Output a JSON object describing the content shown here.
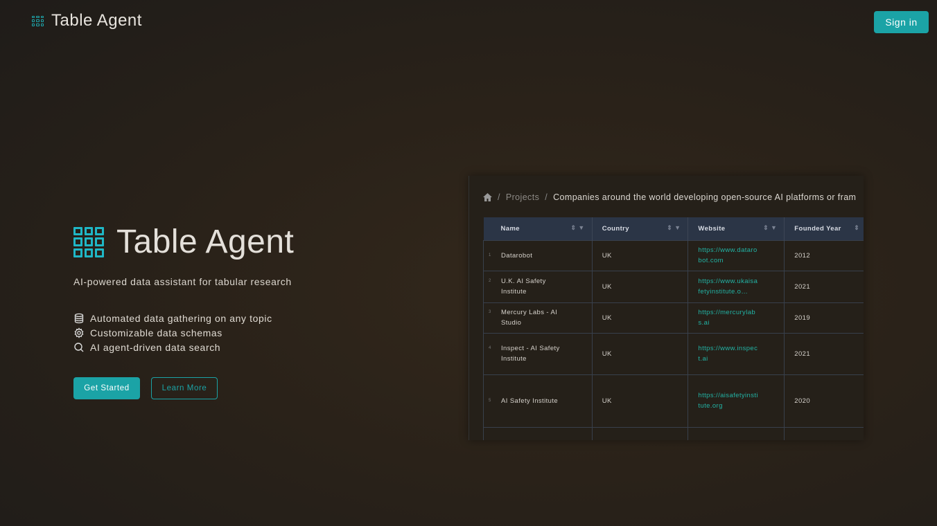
{
  "header": {
    "app_name": "Table Agent",
    "sign_in": "Sign in"
  },
  "hero": {
    "title": "Table Agent",
    "tagline": "AI-powered data assistant for tabular research",
    "features": [
      {
        "icon": "database-icon",
        "text": "Automated data gathering on any topic"
      },
      {
        "icon": "gear-icon",
        "text": "Customizable data schemas"
      },
      {
        "icon": "search-icon",
        "text": "AI agent-driven data search"
      }
    ],
    "get_started": "Get Started",
    "learn_more": "Learn More"
  },
  "preview": {
    "breadcrumb": {
      "sep": "/",
      "projects": "Projects",
      "current": "Companies around the world developing open-source AI platforms or fram"
    },
    "columns": [
      "Name",
      "Country",
      "Website",
      "Founded Year"
    ],
    "rows": [
      {
        "num": "1",
        "name": "Datarobot",
        "country": "UK",
        "website": "https://www.datarobot.com",
        "year": "2012"
      },
      {
        "num": "2",
        "name": "U.K. AI Safety Institute",
        "country": "UK",
        "website": "https://www.ukaisafetyinstitute.o…",
        "year": "2021"
      },
      {
        "num": "3",
        "name": "Mercury Labs - AI Studio",
        "country": "UK",
        "website": "https://mercurylabs.ai",
        "year": "2019"
      },
      {
        "num": "4",
        "name": "Inspect - AI Safety Institute",
        "country": "UK",
        "website": "https://www.inspect.ai",
        "year": "2021"
      },
      {
        "num": "5",
        "name": "AI Safety Institute",
        "country": "UK",
        "website": "https://aisafetyinstitute.org",
        "year": "2020"
      }
    ]
  },
  "colors": {
    "accent": "#1ba3a6",
    "header_row": "#2b3546",
    "link": "#22b3a5"
  }
}
